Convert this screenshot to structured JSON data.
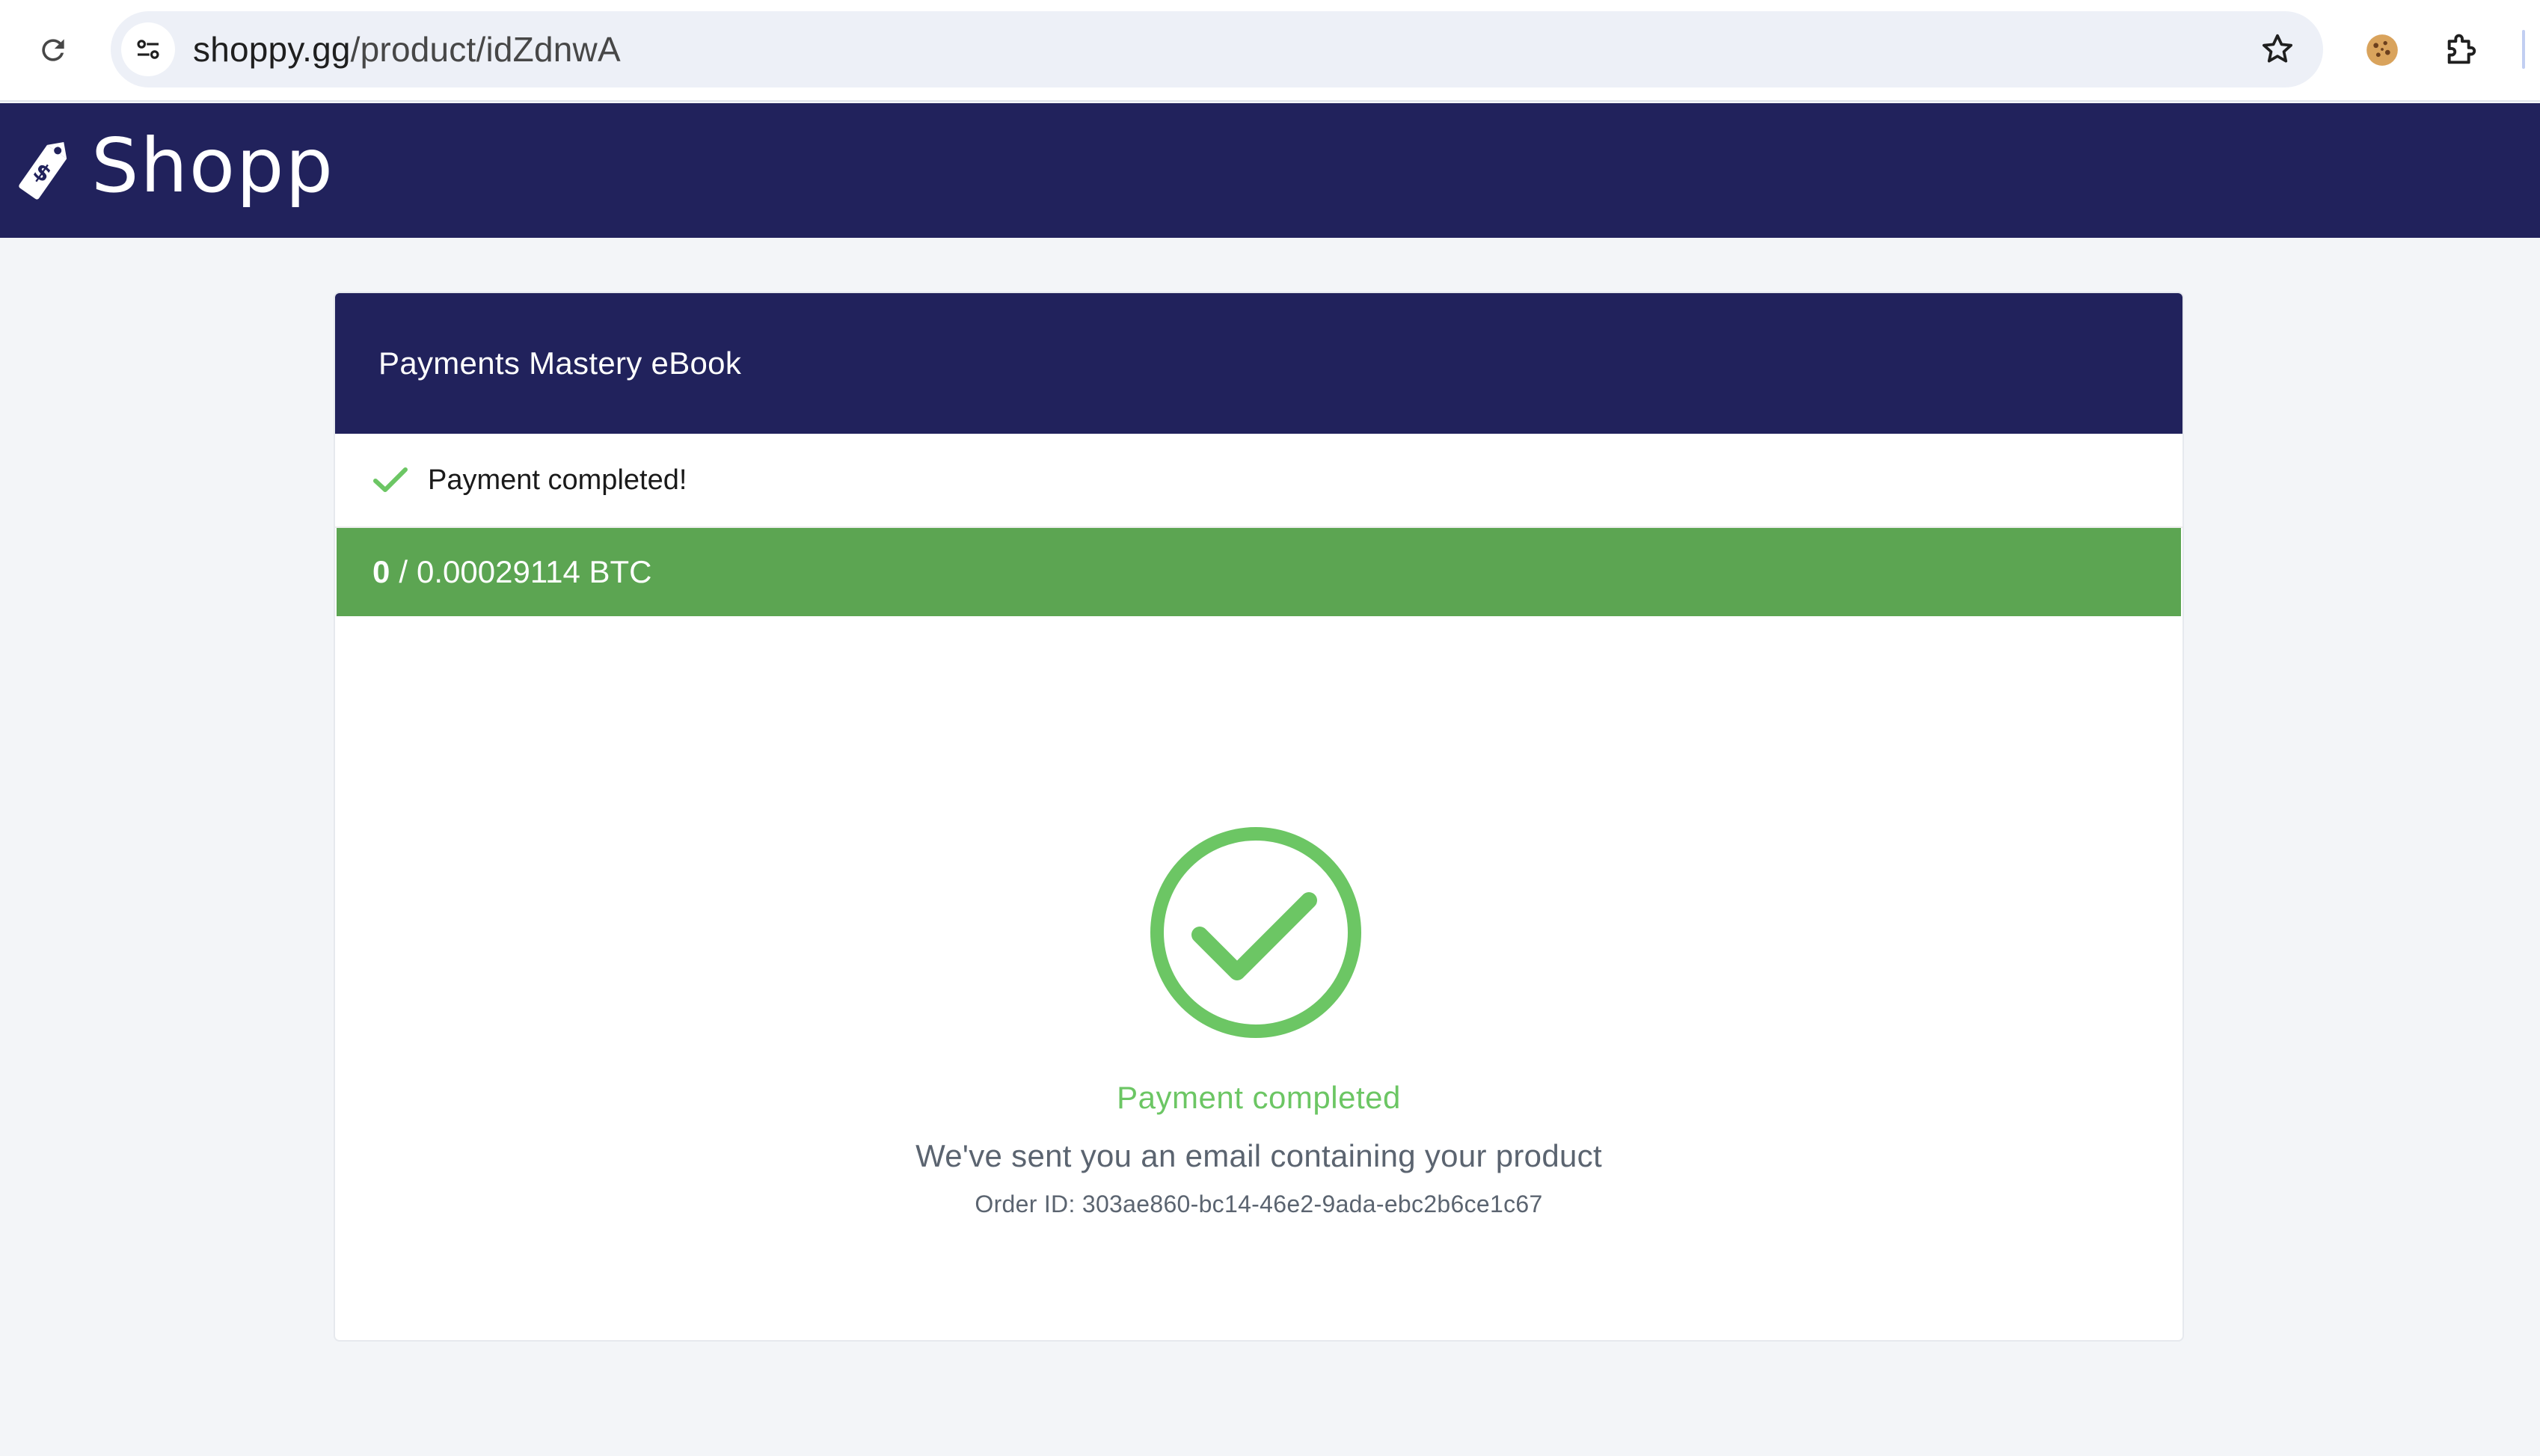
{
  "browser": {
    "url_host": "shoppy.gg",
    "url_path": "/product/idZdnwA"
  },
  "site": {
    "brand": "Shoppy",
    "header_color": "#21225c"
  },
  "product": {
    "title": "Payments Mastery eBook"
  },
  "status": {
    "message": "Payment completed!"
  },
  "payment": {
    "paid": "0",
    "separator": "/",
    "total": "0.00029114 BTC",
    "bar_color": "#5ca552"
  },
  "confirmation": {
    "title": "Payment completed",
    "message": "We've sent you an email containing your product",
    "order_label": "Order ID:",
    "order_id": "303ae860-bc14-46e2-9ada-ebc2b6ce1c67",
    "accent_color": "#6cc664"
  },
  "icons": {
    "reload": "reload-icon",
    "site_info": "tune-icon",
    "bookmark": "star-icon",
    "cookie_extension": "cookie-icon",
    "extensions": "puzzle-icon",
    "brand_logo": "price-tag-icon",
    "status": "checkmark-icon",
    "confirmation": "check-circle-icon"
  }
}
